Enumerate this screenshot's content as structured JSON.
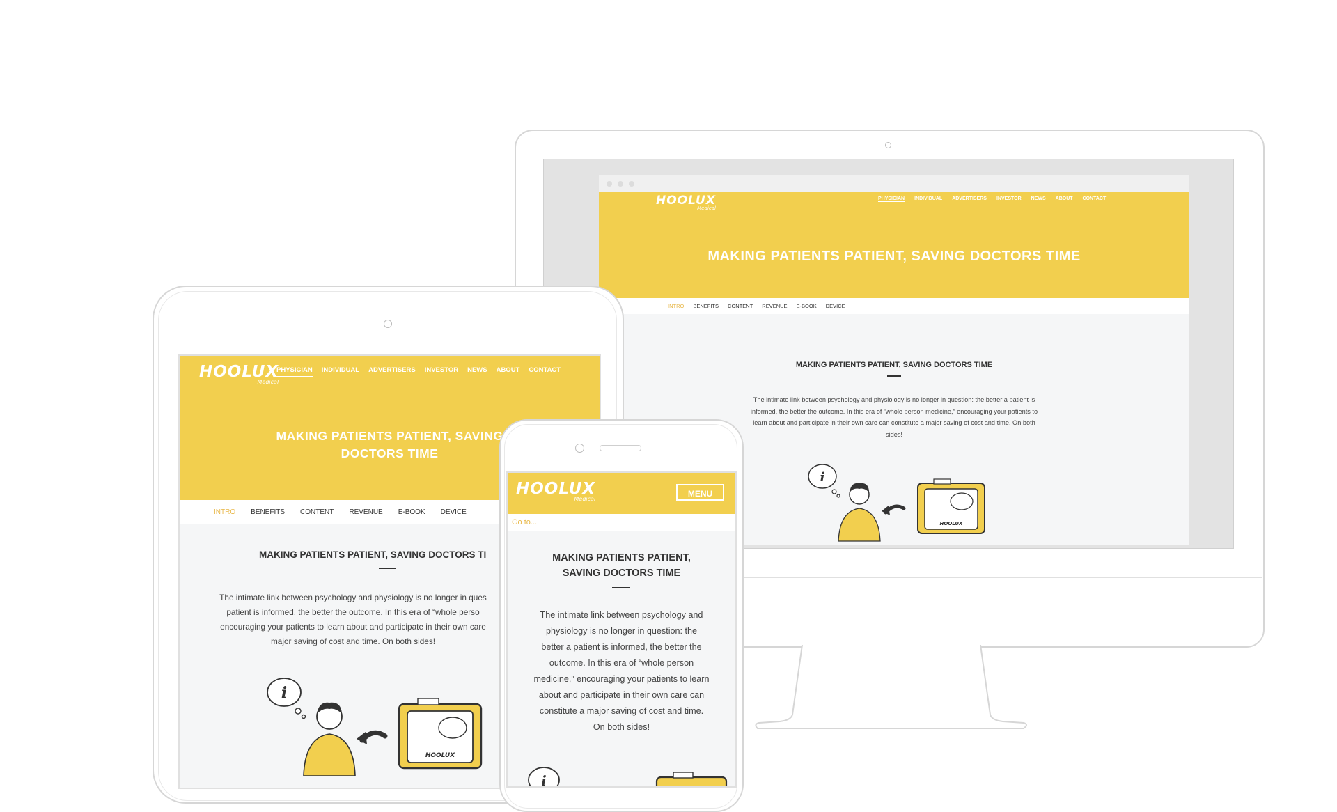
{
  "site": {
    "logo": "HOOLUX",
    "logo_sub": "Medical",
    "nav": [
      "PHYSICIAN",
      "INDIVIDUAL",
      "ADVERTISERS",
      "INVESTOR",
      "NEWS",
      "ABOUT",
      "CONTACT"
    ],
    "hero_title": "MAKING PATIENTS PATIENT, SAVING DOCTORS TIME",
    "tablet_hero_line1": "MAKING PATIENTS PATIENT, SAVING",
    "tablet_hero_line2": "DOCTORS TIME",
    "subnav": [
      "INTRO",
      "BENEFITS",
      "CONTENT",
      "REVENUE",
      "E-BOOK",
      "DEVICE"
    ],
    "section_title": "MAKING PATIENTS PATIENT, SAVING DOCTORS TIME",
    "tablet_section_title": "MAKING PATIENTS PATIENT, SAVING DOCTORS TI",
    "phone_section_line1": "MAKING PATIENTS PATIENT,",
    "phone_section_line2": "SAVING DOCTORS TIME",
    "intro_text": "The intimate link between psychology and physiology is no longer in question: the better a patient is informed, the better the outcome. In this era of “whole person medicine,” encouraging your patients to learn about and participate in their own care can constitute a major saving of cost and time. On both sides!",
    "tablet_lines": [
      "The intimate link between psychology and physiology is no longer in ques",
      "patient is informed, the better the outcome. In this era of “whole perso",
      "encouraging your patients to learn about and participate in their own care",
      "major saving of cost and time. On both sides!"
    ],
    "phone_lines": [
      "The intimate link between psychology and",
      "physiology is no longer in question: the",
      "better a patient is informed, the better the",
      "outcome. In this era of “whole person",
      "medicine,” encouraging your patients to learn",
      "about and participate in their own care can",
      "constitute a major saving of cost and time.",
      "On both sides!"
    ],
    "desktop_lines": [
      "The intimate link between psychology and physiology is no longer in question: the better a patient is",
      "informed, the better the outcome. In this era of “whole person medicine,” encouraging your patients to",
      "learn about and participate in their own care can constitute a major saving of cost and time. On both",
      "sides!"
    ],
    "menu_button": "MENU",
    "goto": "Go to...",
    "screen_brand": "HOOLUX",
    "info_glyph": "i"
  },
  "colors": {
    "brand_yellow": "#f2cf4e",
    "active_orange": "#e8b84a",
    "content_bg": "#f5f6f7",
    "device_outline": "#d4d4d4"
  }
}
